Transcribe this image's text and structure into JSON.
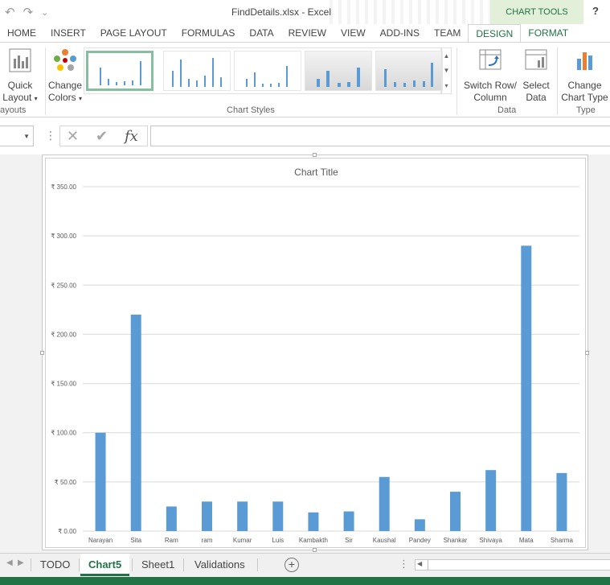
{
  "titlebar": {
    "title": "FindDetails.xlsx - Excel",
    "context_label": "CHART TOOLS",
    "help": "?",
    "undo_icon": "undo-icon",
    "redo_icon": "redo-icon",
    "customize_icon": "customize-qat-icon"
  },
  "tabs": [
    "HOME",
    "INSERT",
    "PAGE LAYOUT",
    "FORMULAS",
    "DATA",
    "REVIEW",
    "VIEW",
    "ADD-INS",
    "TEAM",
    "DESIGN",
    "FORMAT"
  ],
  "active_tab": "DESIGN",
  "ribbon": {
    "quick_layout": {
      "line1": "Quick",
      "line2": "Layout"
    },
    "change_colors": {
      "line1": "Change",
      "line2": "Colors"
    },
    "layouts_group": "ayouts",
    "chart_styles_group": "Chart Styles",
    "switch_row_col": {
      "line1": "Switch Row/",
      "line2": "Column"
    },
    "select_data": {
      "line1": "Select",
      "line2": "Data"
    },
    "data_group": "Data",
    "change_chart_type": {
      "line1": "Change",
      "line2": "Chart Type"
    },
    "type_group": "Type"
  },
  "formula_bar": {
    "cancel_icon": "✕",
    "enter_icon": "✔",
    "fx_icon": "fx",
    "value": ""
  },
  "chart_data": {
    "type": "bar",
    "title": "Chart Title",
    "categories": [
      "Narayan",
      "Sita",
      "Ram",
      "ram",
      "Kumar",
      "Luis",
      "Kambakth",
      "Sir",
      "Kaushal",
      "Pandey",
      "Shankar",
      "Shivaya",
      "Mata",
      "Sharma"
    ],
    "values": [
      100,
      220,
      25,
      30,
      30,
      30,
      19,
      20,
      55,
      12,
      40,
      62,
      290,
      59
    ],
    "ylim": [
      0,
      350
    ],
    "yticks": [
      0,
      50,
      100,
      150,
      200,
      250,
      300,
      350
    ],
    "ytick_labels": [
      "₹ 0.00",
      "₹ 50.00",
      "₹ 100.00",
      "₹ 150.00",
      "₹ 200.00",
      "₹ 250.00",
      "₹ 300.00",
      "₹ 350.00"
    ],
    "grid": true,
    "bar_color": "#5b9bd5"
  },
  "sheet_tabs": [
    "TODO",
    "Chart5",
    "Sheet1",
    "Validations"
  ],
  "active_sheet": "Chart5",
  "colors": {
    "accent": "#217346",
    "context_bg": "#e2efd9",
    "bar": "#5b9bd5"
  }
}
